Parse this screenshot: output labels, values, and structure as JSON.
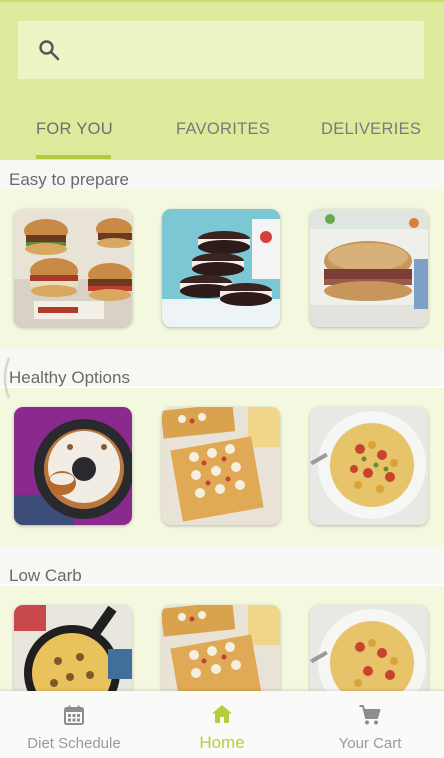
{
  "search": {
    "placeholder": ""
  },
  "tabs": [
    {
      "label": "FOR YOU",
      "active": true
    },
    {
      "label": "FAVORITES",
      "active": false
    },
    {
      "label": "DELIVERIES",
      "active": false
    }
  ],
  "sections": [
    {
      "title": "Easy to prepare",
      "items": [
        "bacon-sliders",
        "chocolate-sandwich-cookies",
        "roast-beef-sandwich"
      ]
    },
    {
      "title": "Healthy Options",
      "items": [
        "bundt-cake",
        "flatbread-pizza",
        "chickpea-pasta"
      ]
    },
    {
      "title": "Low Carb",
      "items": [
        "skillet-casserole",
        "flatbread-pizza",
        "chickpea-pasta"
      ]
    }
  ],
  "bottom_nav": [
    {
      "label": "Diet Schedule",
      "icon": "calendar-icon",
      "active": false
    },
    {
      "label": "Home",
      "icon": "home-icon",
      "active": true
    },
    {
      "label": "Your Cart",
      "icon": "cart-icon",
      "active": false
    }
  ],
  "colors": {
    "header_bg": "#dcea9c",
    "accent": "#b9cc3c",
    "section_bg": "#f3f8df"
  }
}
